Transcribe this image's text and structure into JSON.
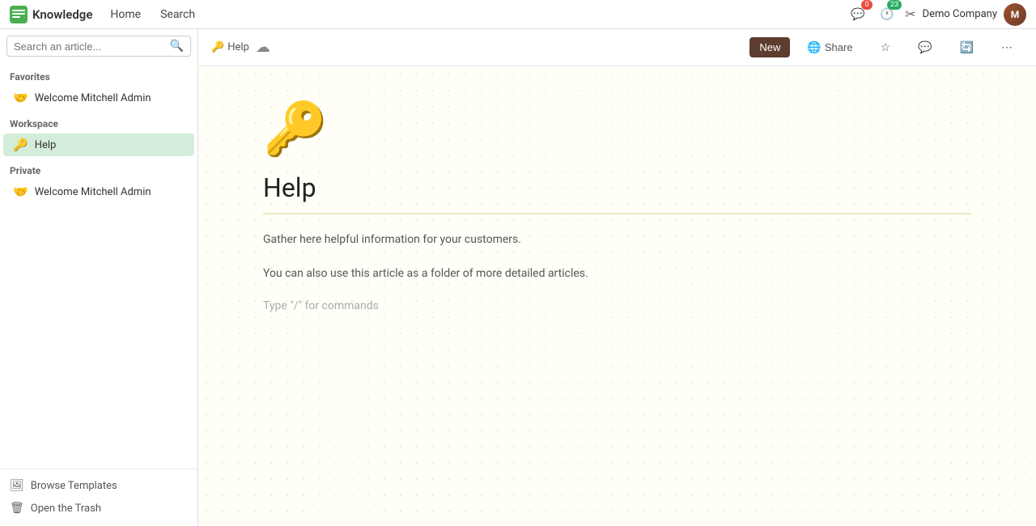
{
  "app": {
    "logo_text": "Knowledge",
    "logo_icon": "📗"
  },
  "nav": {
    "links": [
      {
        "id": "home",
        "label": "Home"
      },
      {
        "id": "search",
        "label": "Search"
      }
    ],
    "notifications": [
      {
        "id": "chat",
        "icon": "💬",
        "count": "0",
        "count_color": "red"
      },
      {
        "id": "activity",
        "icon": "🕐",
        "count": "23",
        "count_color": "green"
      }
    ],
    "scissors_icon": "✂",
    "company": "Demo Company"
  },
  "sidebar": {
    "search_placeholder": "Search an article...",
    "favorites_title": "Favorites",
    "favorites_items": [
      {
        "id": "welcome-fav",
        "emoji": "🤝",
        "label": "Welcome Mitchell Admin"
      }
    ],
    "workspace_title": "Workspace",
    "workspace_items": [
      {
        "id": "help",
        "emoji": "🔑",
        "label": "Help",
        "active": true
      }
    ],
    "private_title": "Private",
    "private_items": [
      {
        "id": "welcome-priv",
        "emoji": "🤝",
        "label": "Welcome Mitchell Admin"
      }
    ],
    "footer": [
      {
        "id": "browse-templates",
        "icon": "🖼",
        "label": "Browse Templates"
      },
      {
        "id": "open-trash",
        "icon": "🗑",
        "label": "Open the Trash"
      }
    ]
  },
  "toolbar": {
    "breadcrumb_icon": "🔑",
    "breadcrumb_label": "Help",
    "cloud_icon": "☁",
    "new_label": "New",
    "share_label": "Share",
    "share_icon": "🌐",
    "star_icon": "☆",
    "comment_icon": "💬",
    "history_icon": "🔄",
    "more_icon": "⋯"
  },
  "article": {
    "icon": "🔑",
    "title": "Help",
    "paragraph1": "Gather here helpful information for your customers.",
    "paragraph2": "You can also use this article as a folder of more detailed articles.",
    "command_hint": "Type \"/\" for commands"
  }
}
